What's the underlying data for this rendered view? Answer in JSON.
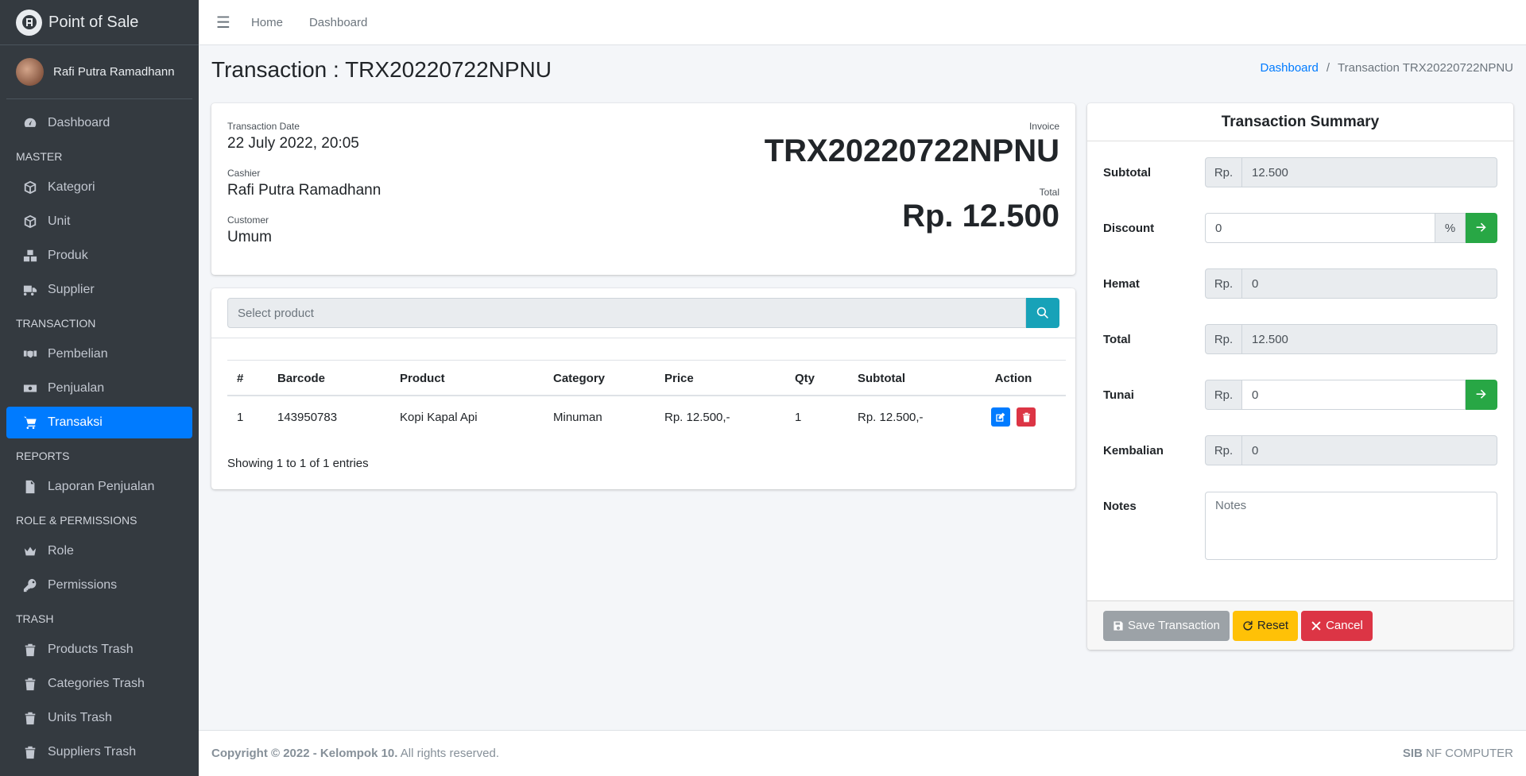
{
  "brand": {
    "name": "Point of Sale",
    "icon": "app-logo-icon"
  },
  "user": {
    "name": "Rafi Putra Ramadhann"
  },
  "sidebar": {
    "dashboard": "Dashboard",
    "section_master": "MASTER",
    "kategori": "Kategori",
    "unit": "Unit",
    "produk": "Produk",
    "supplier": "Supplier",
    "section_transaction": "TRANSACTION",
    "pembelian": "Pembelian",
    "penjualan": "Penjualan",
    "transaksi": "Transaksi",
    "section_reports": "REPORTS",
    "laporan": "Laporan Penjualan",
    "section_role": "ROLE & PERMISSIONS",
    "role": "Role",
    "permissions": "Permissions",
    "section_trash": "TRASH",
    "products_trash": "Products Trash",
    "categories_trash": "Categories Trash",
    "units_trash": "Units Trash",
    "suppliers_trash": "Suppliers Trash"
  },
  "topbar": {
    "home": "Home",
    "dashboard": "Dashboard"
  },
  "page": {
    "title": "Transaction : TRX20220722NPNU",
    "breadcrumb_link": "Dashboard",
    "breadcrumb_sep": "/",
    "breadcrumb_current": "Transaction TRX20220722NPNU"
  },
  "info": {
    "date_label": "Transaction Date",
    "date_value": "22 July 2022, 20:05",
    "cashier_label": "Cashier",
    "cashier_value": "Rafi Putra Ramadhann",
    "customer_label": "Customer",
    "customer_value": "Umum",
    "invoice_label": "Invoice",
    "invoice_value": "TRX20220722NPNU",
    "total_label": "Total",
    "total_value": "Rp. 12.500"
  },
  "products": {
    "search_placeholder": "Select product",
    "headers": {
      "num": "#",
      "barcode": "Barcode",
      "product": "Product",
      "category": "Category",
      "price": "Price",
      "qty": "Qty",
      "subtotal": "Subtotal",
      "action": "Action"
    },
    "rows": [
      {
        "num": "1",
        "barcode": "143950783",
        "product": "Kopi Kapal Api",
        "category": "Minuman",
        "price": "Rp. 12.500,-",
        "qty": "1",
        "subtotal": "Rp. 12.500,-"
      }
    ],
    "showing": "Showing 1 to 1 of 1 entries"
  },
  "summary": {
    "title": "Transaction Summary",
    "currency": "Rp.",
    "percent": "%",
    "subtotal_label": "Subtotal",
    "subtotal_value": "12.500",
    "discount_label": "Discount",
    "discount_value": "0",
    "hemat_label": "Hemat",
    "hemat_value": "0",
    "total_label": "Total",
    "total_value": "12.500",
    "tunai_label": "Tunai",
    "tunai_value": "0",
    "kembalian_label": "Kembalian",
    "kembalian_value": "0",
    "notes_label": "Notes",
    "notes_placeholder": "Notes",
    "save_label": "Save Transaction",
    "reset_label": "Reset",
    "cancel_label": "Cancel"
  },
  "footer": {
    "copyright_bold": "Copyright © 2022 - Kelompok 10.",
    "copyright_rest": " All rights reserved.",
    "right_bold": "SIB",
    "right_rest": " NF COMPUTER"
  },
  "colors": {
    "sidebar_bg": "#343a40",
    "active": "#007bff",
    "info": "#17a2b8",
    "success": "#28a745",
    "warning": "#ffc107",
    "danger": "#dc3545"
  }
}
